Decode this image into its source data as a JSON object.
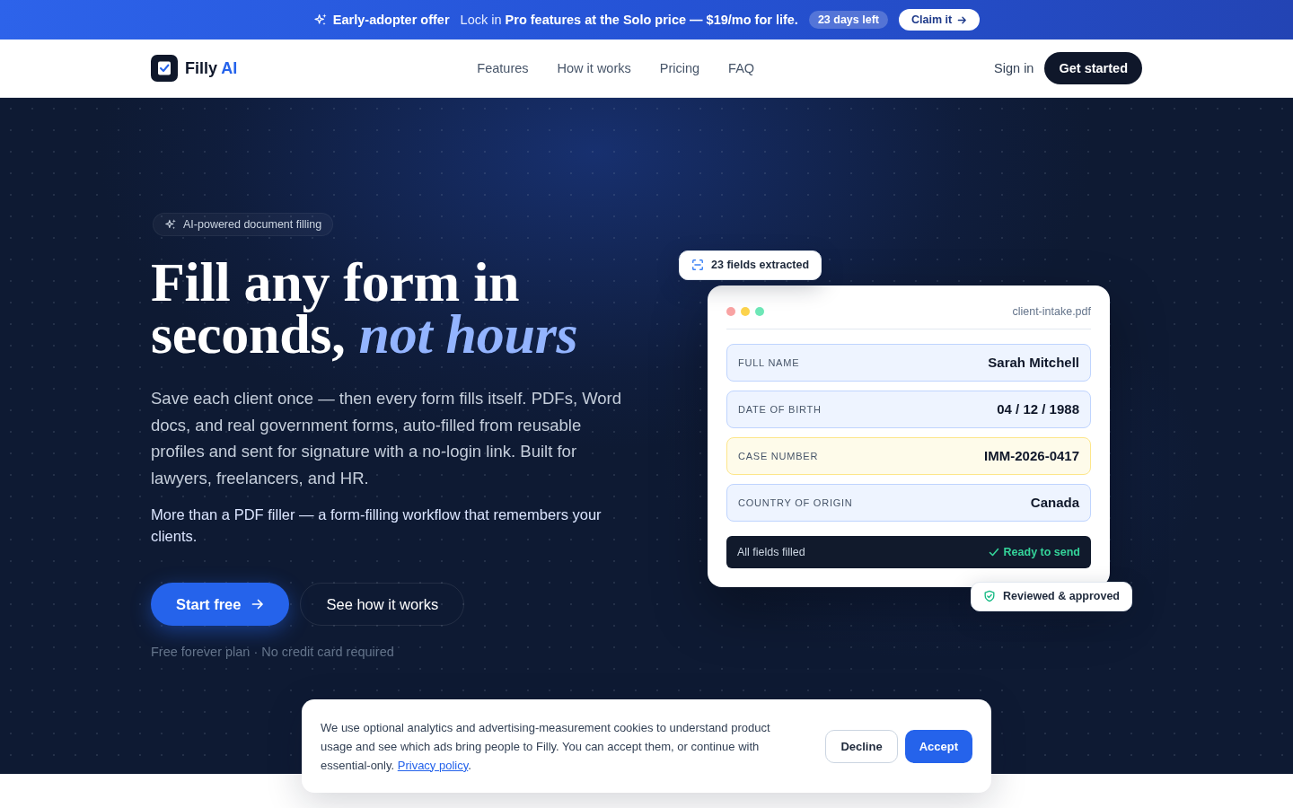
{
  "promo_bar": {
    "title": "Early-adopter offer",
    "message": "Lock in **Pro features at the Solo price — $19/mo for life.**",
    "countdown": "23 days left",
    "button": "Claim it"
  },
  "nav": {
    "brand": {
      "name": "Filly",
      "suffix": "AI"
    },
    "links": [
      "Features",
      "How it works",
      "Pricing",
      "FAQ"
    ],
    "sign_in": "Sign in",
    "cta": "Get started"
  },
  "hero": {
    "badge": "AI-powered document filling",
    "headline": "Fill any form in seconds, *not hours*",
    "description": "Save each client once — then every form fills itself. PDFs, Word docs, and real government forms, auto-filled from reusable profiles and sent for signature with a no-login link. Built for lawyers, freelancers, and HR.",
    "tagline": "More than a PDF filler — a form-filling workflow that remembers your clients.",
    "primary_button": "Start free",
    "secondary_button": "See how it works",
    "note": "Free forever plan · No credit card required"
  },
  "preview": {
    "extracted_badge": "23 fields extracted",
    "file_name": "client-intake.pdf",
    "fields": [
      {
        "label": "FULL NAME",
        "value": "Sarah Mitchell",
        "highlighted": false
      },
      {
        "label": "DATE OF BIRTH",
        "value": "04 / 12 / 1988",
        "highlighted": false
      },
      {
        "label": "CASE NUMBER",
        "value": "IMM-2026-0417",
        "highlighted": true
      },
      {
        "label": "COUNTRY OF ORIGIN",
        "value": "Canada",
        "highlighted": false
      }
    ],
    "status": {
      "label": "All fields filled",
      "state": "Ready to send"
    },
    "approval_badge": "Reviewed & approved"
  },
  "cookie_banner": {
    "message": "We use optional analytics and advertising-measurement cookies to understand product usage and see which ads bring people to Filly. You can accept them, or continue with essential-only.",
    "link": "Privacy policy",
    "end": ".",
    "decline": "Decline",
    "accept": "Accept"
  }
}
